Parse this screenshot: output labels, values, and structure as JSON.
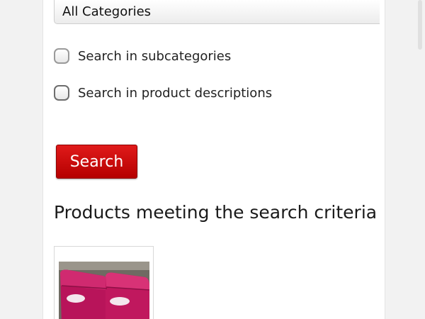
{
  "search_form": {
    "category_select": {
      "selected": "All Categories"
    },
    "options": [
      {
        "label": "Search in subcategories",
        "checked": false
      },
      {
        "label": "Search in product descriptions",
        "checked": false
      }
    ],
    "search_button_label": "Search"
  },
  "results": {
    "heading": "Products meeting the search criteria"
  },
  "colors": {
    "accent": "#cc0000",
    "product_pink": "#c2185b"
  }
}
